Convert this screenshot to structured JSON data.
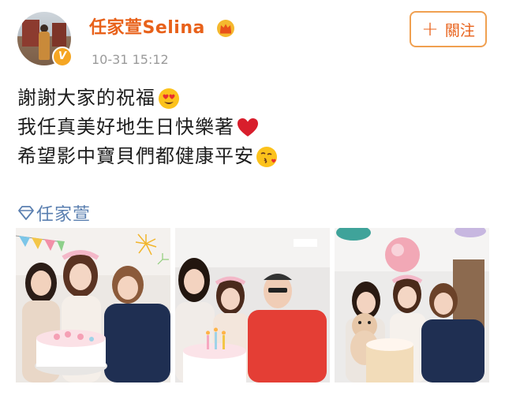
{
  "post": {
    "author": {
      "name": "任家萱Selina",
      "avatar_icon": "avatar-photo",
      "verified_badge": "V",
      "crown_icon": "crown-icon"
    },
    "timestamp": "10-31 15:12",
    "follow_button": {
      "label": "關注",
      "icon": "plus-icon"
    },
    "content": {
      "lines": [
        {
          "text": "謝謝大家的祝福",
          "emoji": "heart-eyes-emoji"
        },
        {
          "text": "我任真美好地生日快樂著",
          "emoji": "red-heart-emoji"
        },
        {
          "text": "希望影中寶貝們都健康平安",
          "emoji": "kiss-emoji"
        }
      ]
    },
    "topic": {
      "label": "任家萱",
      "icon": "diamond-icon"
    },
    "photos": [
      {
        "name": "birthday-photo-1"
      },
      {
        "name": "birthday-photo-2"
      },
      {
        "name": "birthday-photo-3"
      }
    ]
  },
  "colors": {
    "username": "#e8611a",
    "follow_border": "#f0a050",
    "timestamp": "#9a9a9a",
    "topic": "#5a7fb0",
    "verified": "#f5a623"
  }
}
